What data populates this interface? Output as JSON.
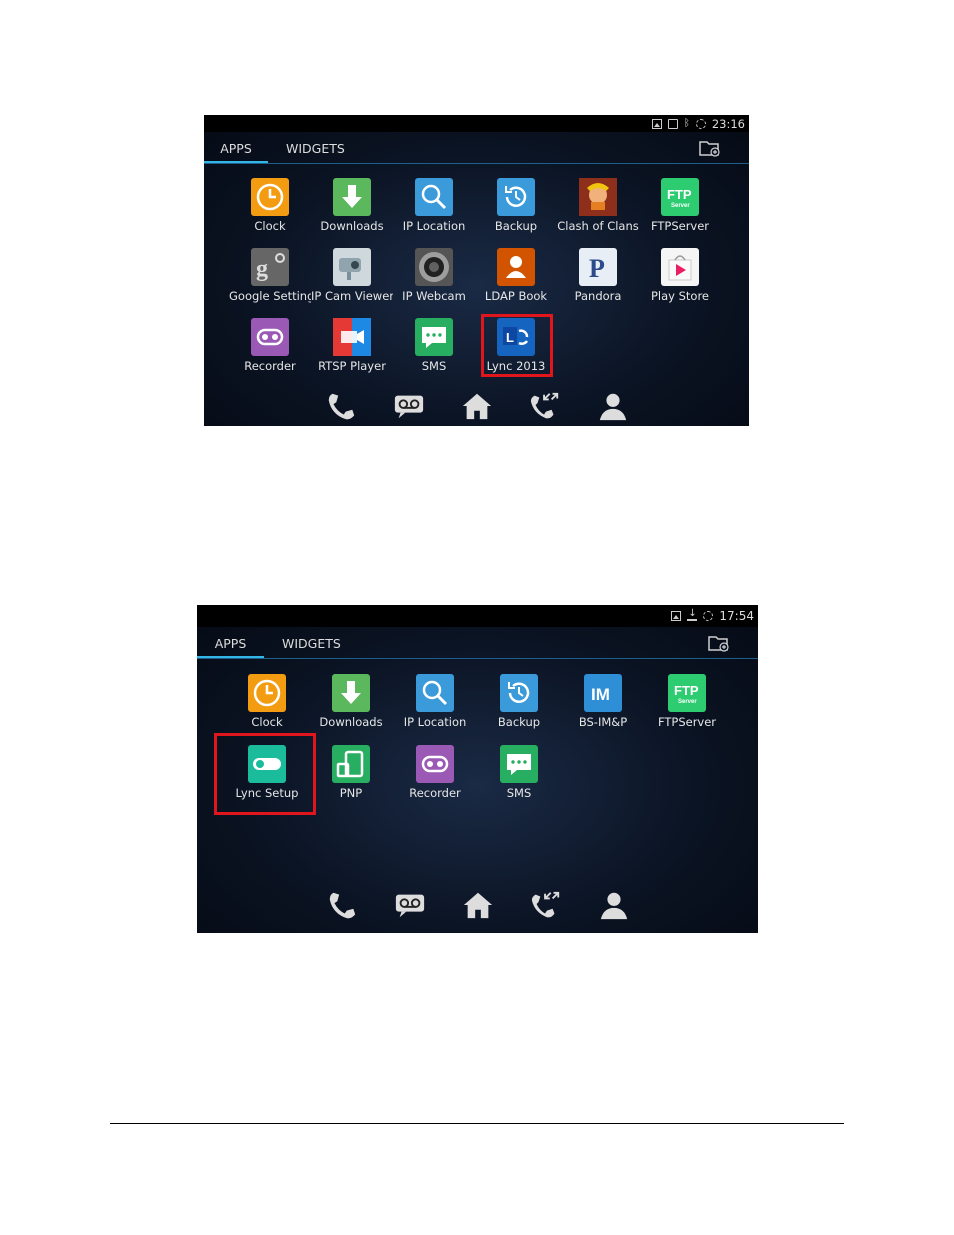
{
  "screen1": {
    "status": {
      "time": "23:16",
      "icons": [
        "image-icon",
        "sim-icon",
        "bluetooth-icon",
        "sync-icon"
      ]
    },
    "tabs": {
      "apps": "APPS",
      "widgets": "WIDGETS"
    },
    "apps": [
      {
        "label": "Clock",
        "icon": "clock-icon",
        "color": "#f39c12"
      },
      {
        "label": "Downloads",
        "icon": "download-icon",
        "color": "#5cb85c"
      },
      {
        "label": "IP Location",
        "icon": "magnifier-icon",
        "color": "#3b9ad9"
      },
      {
        "label": "Backup",
        "icon": "backup-icon",
        "color": "#3b9ad9"
      },
      {
        "label": "Clash of Clans",
        "icon": "clash-of-clans-icon",
        "color": "#c0392b"
      },
      {
        "label": "FTPServer",
        "icon": "ftp-icon",
        "color": "#2ecc71",
        "text": "FTP",
        "sub": "Server"
      },
      {
        "label": "Google Setting",
        "icon": "google-settings-icon",
        "color": "#666666",
        "text": "g"
      },
      {
        "label": "IP Cam Viewer",
        "icon": "ip-camera-icon",
        "color": "#cfd8dc"
      },
      {
        "label": "IP Webcam",
        "icon": "webcam-icon",
        "color": "#555555"
      },
      {
        "label": "LDAP Book",
        "icon": "ldap-book-icon",
        "color": "#d35400"
      },
      {
        "label": "Pandora",
        "icon": "pandora-icon",
        "color": "#e8eef6",
        "text": "P"
      },
      {
        "label": "Play Store",
        "icon": "play-store-icon",
        "color": "#f5f5f5"
      },
      {
        "label": "Recorder",
        "icon": "recorder-icon",
        "color": "#9b59b6"
      },
      {
        "label": "RTSP Player",
        "icon": "rtsp-player-icon",
        "color": "#c0392b"
      },
      {
        "label": "SMS",
        "icon": "sms-icon",
        "color": "#27ae60"
      },
      {
        "label": "Lync 2013",
        "icon": "lync-icon",
        "color": "#1565c0",
        "text": "L"
      }
    ],
    "dock": [
      "phone-icon",
      "voicemail-icon",
      "home-icon",
      "call-log-icon",
      "contacts-icon"
    ]
  },
  "screen2": {
    "status": {
      "time": "17:54",
      "icons": [
        "image-icon",
        "download-icon",
        "sync-icon"
      ]
    },
    "tabs": {
      "apps": "APPS",
      "widgets": "WIDGETS"
    },
    "apps": [
      {
        "label": "Clock",
        "icon": "clock-icon",
        "color": "#f39c12"
      },
      {
        "label": "Downloads",
        "icon": "download-icon",
        "color": "#5cb85c"
      },
      {
        "label": "IP Location",
        "icon": "magnifier-icon",
        "color": "#3b9ad9"
      },
      {
        "label": "Backup",
        "icon": "backup-icon",
        "color": "#3b9ad9"
      },
      {
        "label": "BS-IM&P",
        "icon": "im-icon",
        "color": "#2f8fd6",
        "text": "IM"
      },
      {
        "label": "FTPServer",
        "icon": "ftp-icon",
        "color": "#2ecc71",
        "text": "FTP",
        "sub": "Server"
      },
      {
        "label": "Lync Setup",
        "icon": "toggle-icon",
        "color": "#1abc9c"
      },
      {
        "label": "PNP",
        "icon": "pnp-icon",
        "color": "#27ae60"
      },
      {
        "label": "Recorder",
        "icon": "recorder-icon",
        "color": "#9b59b6"
      },
      {
        "label": "SMS",
        "icon": "sms-icon",
        "color": "#27ae60"
      }
    ],
    "dock": [
      "phone-icon",
      "voicemail-icon",
      "home-icon",
      "call-log-icon",
      "contacts-icon"
    ]
  },
  "highlight_color": "#e0161c",
  "accent_color": "#33b5e5"
}
